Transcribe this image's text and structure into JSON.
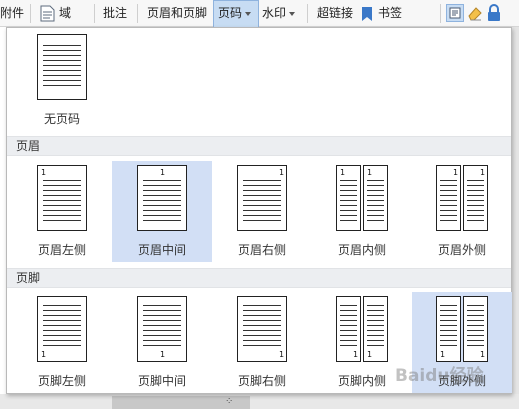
{
  "toolbar": {
    "attachment": "附件",
    "field": "域",
    "comment": "批注",
    "header_footer": "页眉和页脚",
    "page_number": "页码",
    "watermark": "水印",
    "hyperlink": "超链接",
    "bookmark": "书签"
  },
  "menu": {
    "none_label": "无页码",
    "header_section": "页眉",
    "footer_section": "页脚",
    "page_num_glyph": "1",
    "header_items": [
      {
        "label": "页眉左侧"
      },
      {
        "label": "页眉中间"
      },
      {
        "label": "页眉右侧"
      },
      {
        "label": "页眉内侧"
      },
      {
        "label": "页眉外侧"
      }
    ],
    "footer_items": [
      {
        "label": "页脚左侧"
      },
      {
        "label": "页脚中间"
      },
      {
        "label": "页脚右侧"
      },
      {
        "label": "页脚内侧"
      },
      {
        "label": "页脚外侧"
      }
    ]
  },
  "watermark_text": "Baidu经验",
  "colors": {
    "selected_bg": "#d2dff5",
    "section_bg": "#eceef1",
    "active_tab": "#c7dcf3"
  }
}
